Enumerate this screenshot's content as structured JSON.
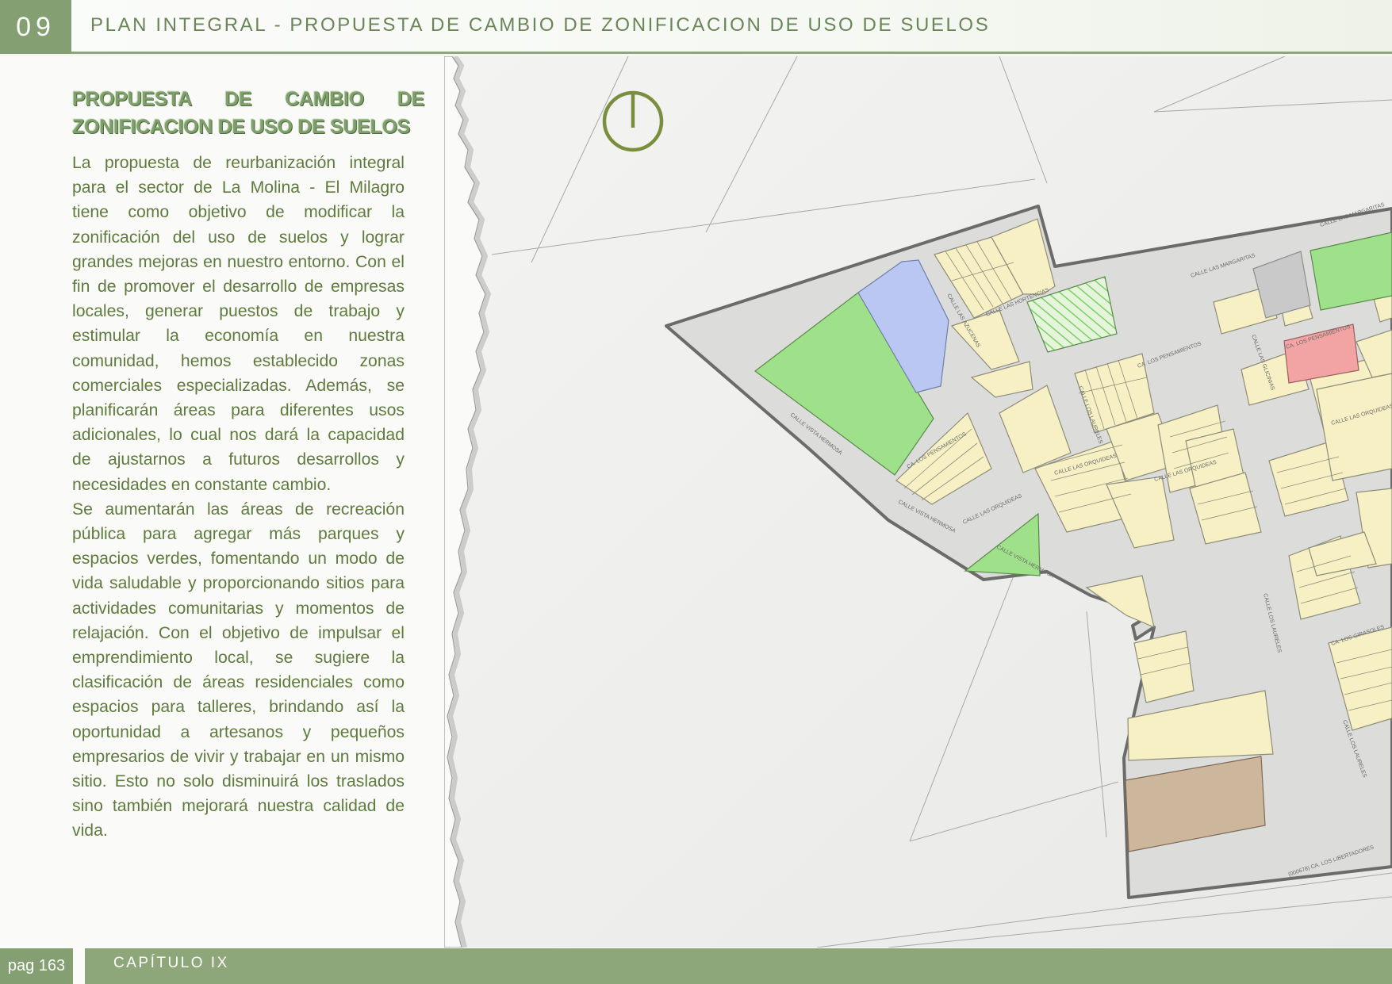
{
  "header": {
    "chapter_number": "09",
    "title": "PLAN INTEGRAL - PROPUESTA DE CAMBIO DE ZONIFICACION DE USO DE SUELOS"
  },
  "section": {
    "title": "PROPUESTA DE CAMBIO DE ZONIFICACION DE USO DE SUELOS",
    "paragraphs": [
      "La propuesta de reurbanización integral para el sector de La Molina - El Milagro tiene como objetivo de modificar la zonificación del uso de suelos y lograr grandes mejoras en nuestro entorno. Con el fin de promover el desarrollo de empresas locales, generar puestos de trabajo y estimular la economía en nuestra comunidad, hemos establecido zonas comerciales especializadas. Además, se planificarán áreas para diferentes usos adicionales, lo cual nos dará la capacidad de ajustarnos a futuros desarrollos y necesidades en constante cambio.",
      "Se aumentarán las áreas de recreación pública para agregar más parques y espacios verdes, fomentando un modo de vida saludable y proporcionando sitios para actividades comunitarias y momentos de relajación. Con el objetivo de impulsar el emprendimiento local, se sugiere la clasificación de áreas residenciales como espacios para talleres, brindando así la oportunidad a artesanos y pequeños empresarios de vivir y trabajar en un mismo sitio. Esto no solo disminuirá los traslados sino también mejorará nuestra calidad de vida."
    ]
  },
  "map": {
    "street_labels": [
      "CALLE LAS MARGARITAS",
      "CALLE LAS MARGARITAS",
      "CALLE LAS AZUCENAS",
      "CALLE LAS HORTENCIAS",
      "CALLE LAS GLICINIAS",
      "CA. LOS PENSAMIENTOS",
      "CA. LOS PENSAMIENTOS",
      "CA. LOS PENSAMIENTOS",
      "CALLE VISTA HERMOSA",
      "CALLE VISTA HERMOSA",
      "CALLE VISTA HERMOSA",
      "CALLE LAS ORQUIDEAS",
      "CALLE LAS ORQUIDEAS",
      "CALLE LAS ORQUIDEAS",
      "CALLE LAS ORQUIDEAS",
      "CALLE LOS LAURELES",
      "CALLE LOS LAURELES",
      "CALLE LOS LAURELES",
      "CA. LOS GIRASOLES",
      "(000678) CA. LOS LIBERTADORES"
    ],
    "colors": {
      "residential": "#f6f0c4",
      "park": "#9fe08a",
      "education": "#b9c7f2",
      "commerce": "#f2a3a3",
      "other": "#c9c9c9",
      "industrial": "#cdb79c",
      "boundary": "#666666",
      "accent": "#7a8f3e"
    },
    "north_icon": "north-arrow-icon"
  },
  "footer": {
    "page": "pag 163",
    "chapter": "CAPÍTULO IX"
  }
}
